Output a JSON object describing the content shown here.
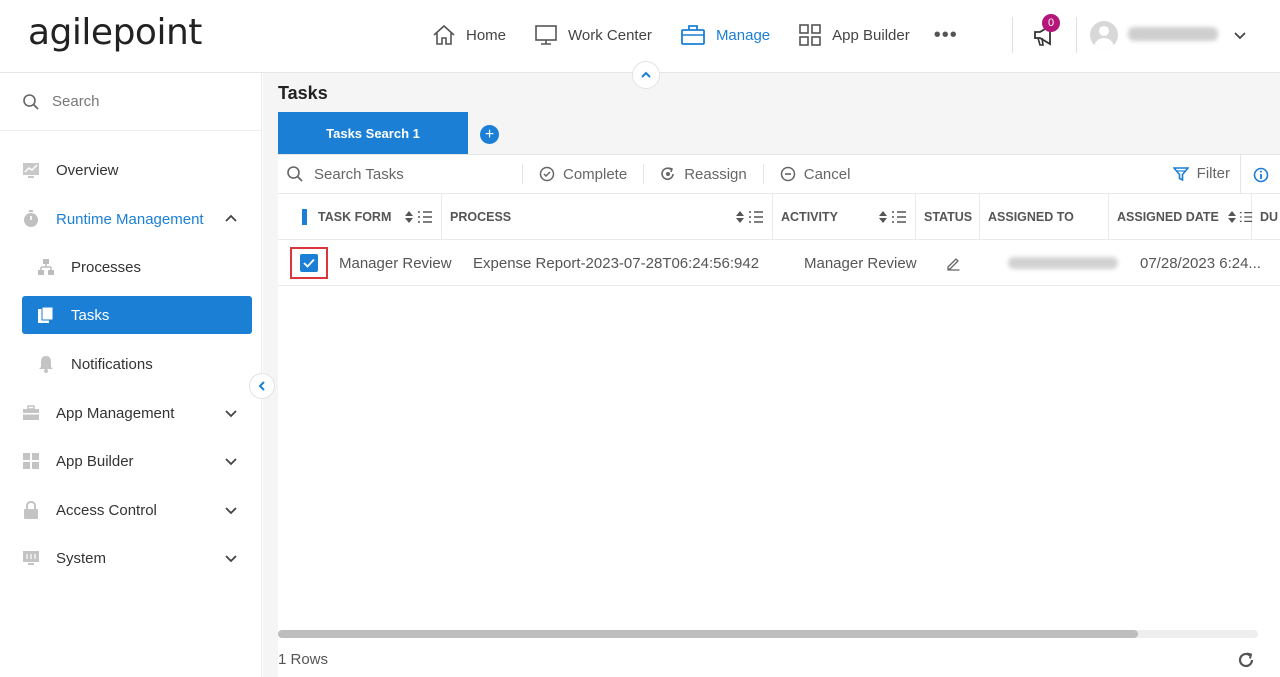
{
  "header": {
    "logo_text": "agilepoint",
    "nav": [
      {
        "label": "Home",
        "icon": "home-icon"
      },
      {
        "label": "Work Center",
        "icon": "monitor-icon"
      },
      {
        "label": "Manage",
        "icon": "briefcase-icon",
        "active": true
      },
      {
        "label": "App Builder",
        "icon": "grid-icon"
      }
    ],
    "more": "•••",
    "notification_count": "0"
  },
  "sidebar": {
    "search_placeholder": "Search",
    "items": [
      {
        "label": "Overview",
        "icon": "chart-icon"
      },
      {
        "label": "Runtime Management",
        "icon": "timer-icon",
        "expanded": true
      },
      {
        "label": "Processes",
        "icon": "hierarchy-icon"
      },
      {
        "label": "Tasks",
        "icon": "tasks-icon",
        "selected": true
      },
      {
        "label": "Notifications",
        "icon": "bell-icon"
      },
      {
        "label": "App Management",
        "icon": "toolbox-icon"
      },
      {
        "label": "App Builder",
        "icon": "widgets-icon"
      },
      {
        "label": "Access Control",
        "icon": "lock-icon"
      },
      {
        "label": "System",
        "icon": "system-icon"
      }
    ]
  },
  "main": {
    "title": "Tasks",
    "tab_label": "Tasks Search 1",
    "add_tab": "+",
    "toolbar": {
      "search_placeholder": "Search Tasks",
      "complete": "Complete",
      "reassign": "Reassign",
      "cancel": "Cancel",
      "filter": "Filter"
    },
    "columns": [
      "Task Form",
      "Process",
      "Activity",
      "Status",
      "Assigned To",
      "Assigned Date",
      "Du"
    ],
    "rows": [
      {
        "checked": true,
        "task_form": "Manager Review",
        "process": "Expense Report-2023-07-28T06:24:56:942",
        "activity": "Manager Review",
        "assigned_date": "07/28/2023 6:24..."
      }
    ],
    "row_count": "1 Rows"
  },
  "colors": {
    "accent": "#1b7fd6",
    "badge": "#b5167a",
    "highlight": "#d9363e"
  }
}
